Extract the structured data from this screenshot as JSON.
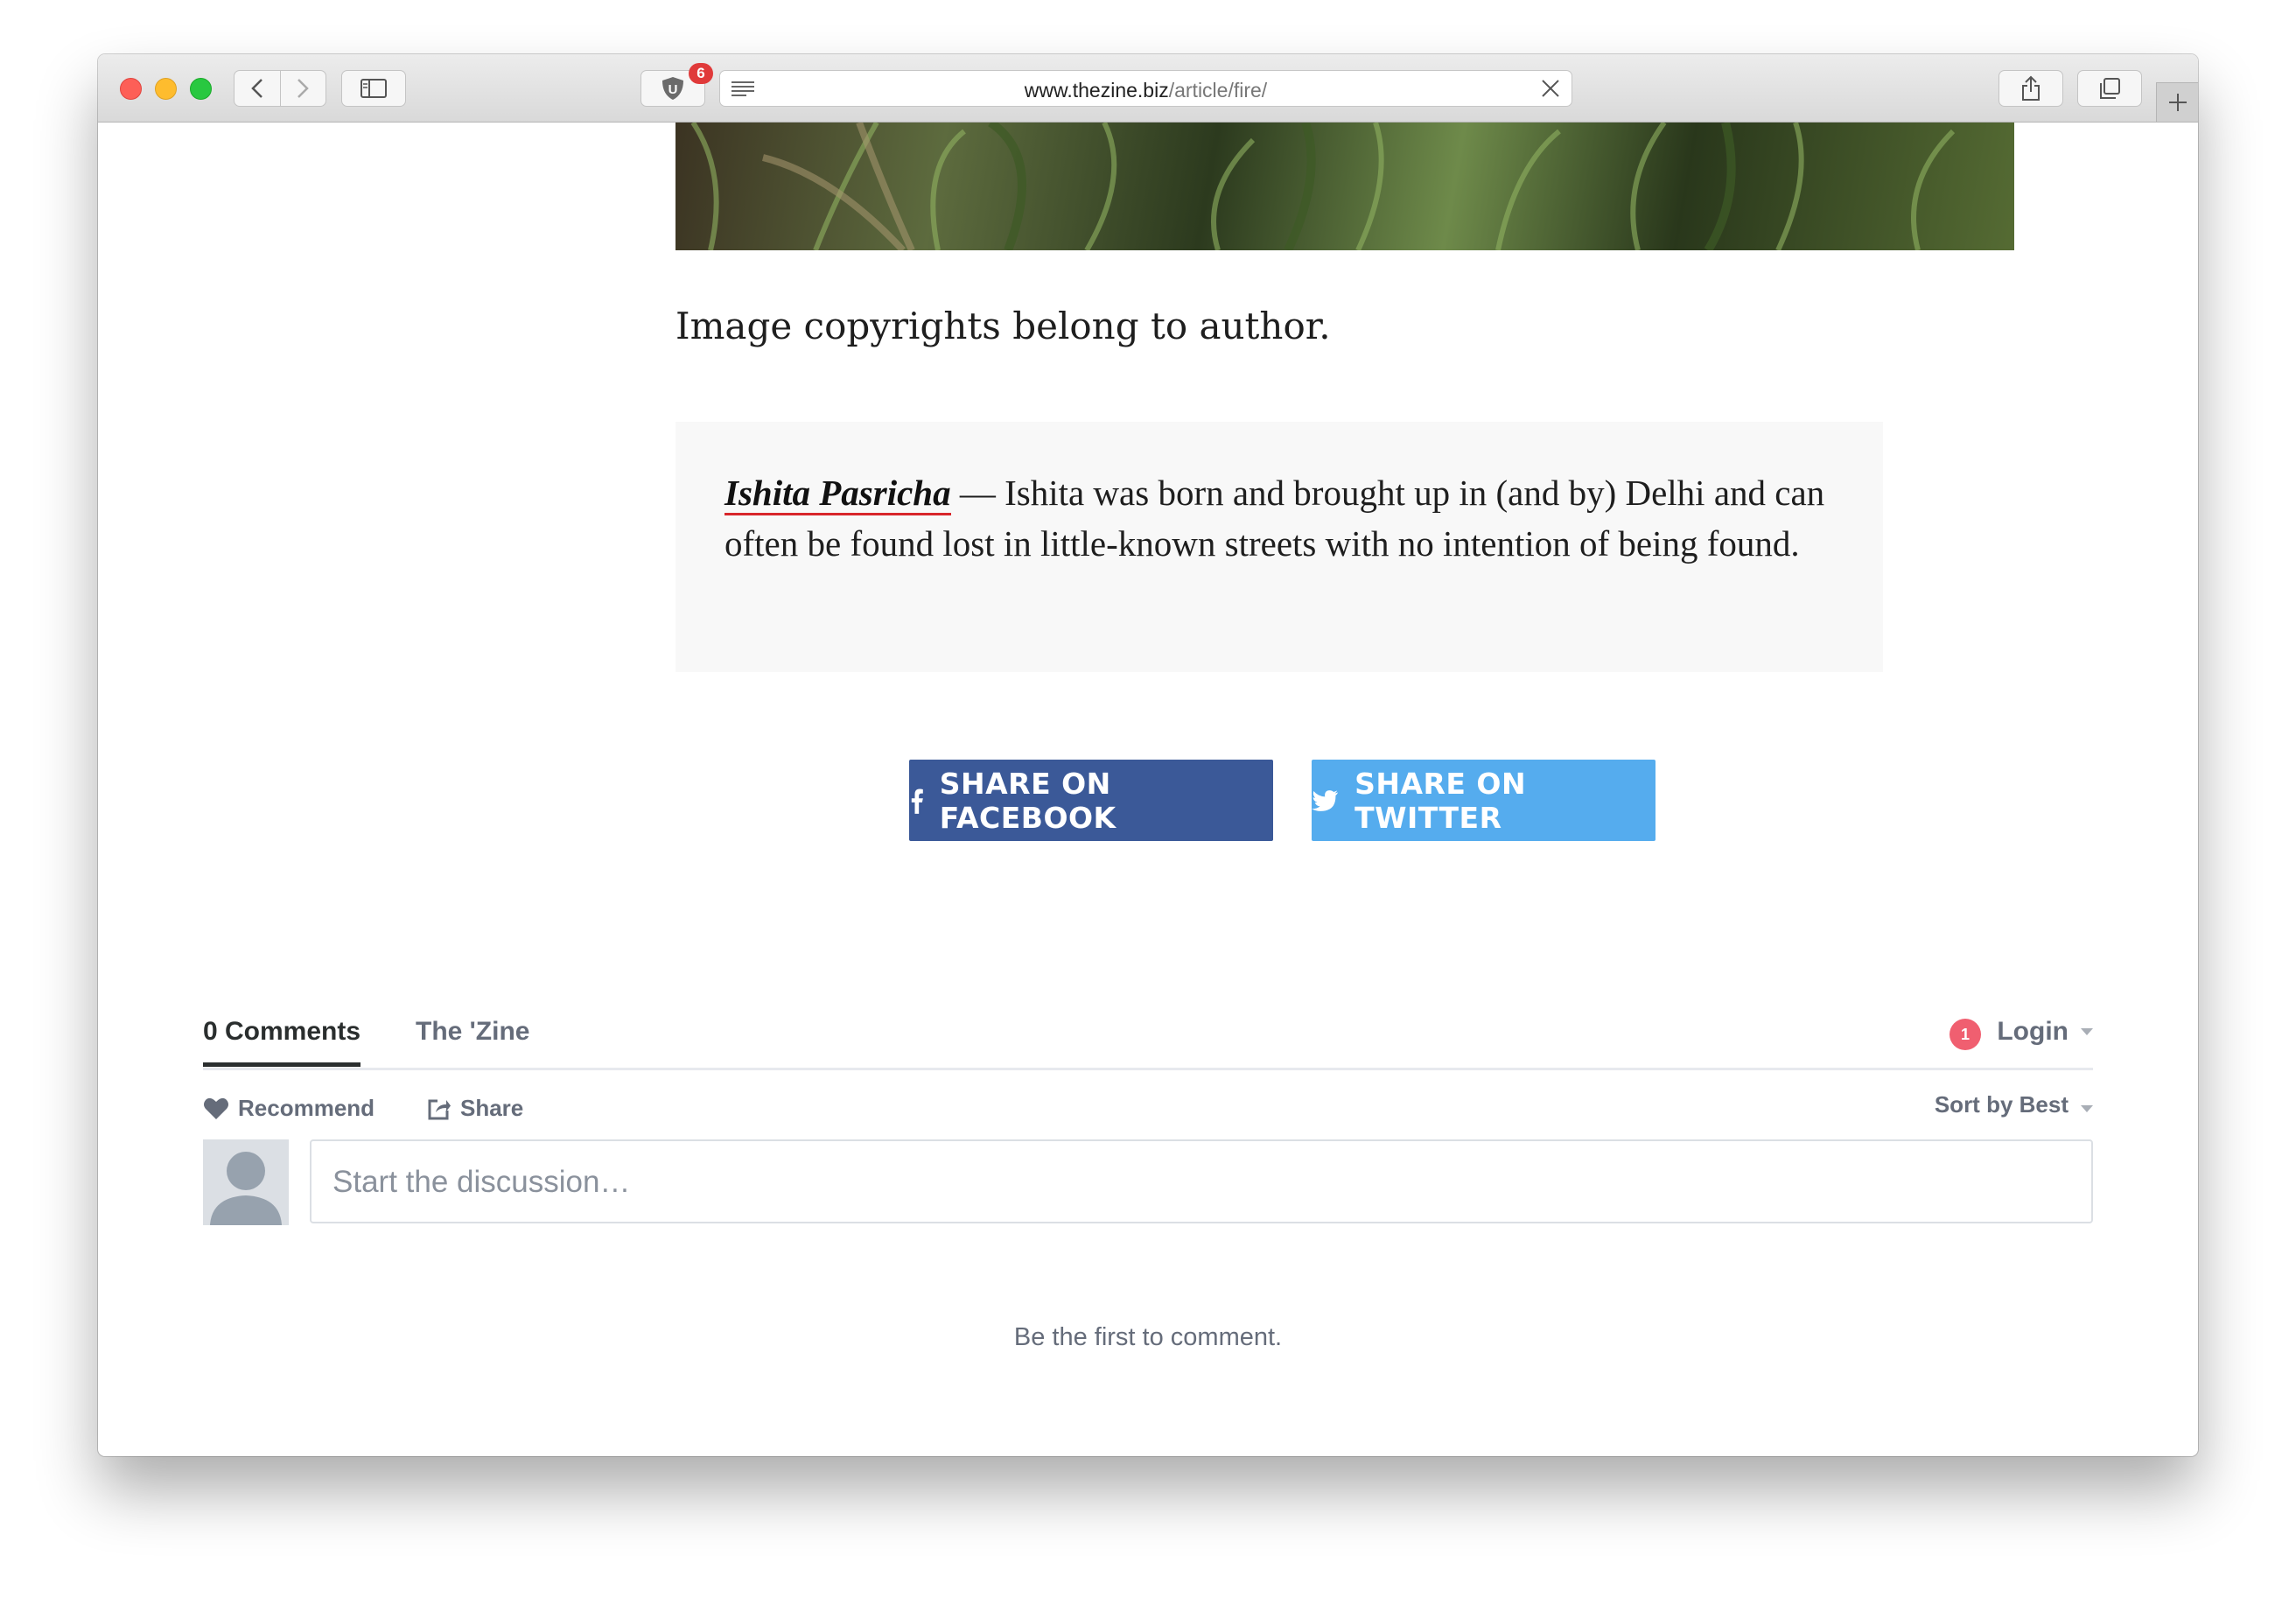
{
  "browser": {
    "url_domain": "www.thezine.biz",
    "url_path": "/article/fire/",
    "extension_badge_count": "6",
    "extension_icon_letter": "U"
  },
  "article": {
    "image_caption": "Image copyrights belong to author.",
    "author_name": "Ishita Pasricha",
    "bio_text": " — Ishita was born and brought up in (and by) Delhi and can often be found lost in little-known streets with no intention of being found."
  },
  "share": {
    "facebook_label": "SHARE ON FACEBOOK",
    "twitter_label": "SHARE ON TWITTER",
    "facebook_color": "#3b5998",
    "twitter_color": "#55acee"
  },
  "comments": {
    "tab_comments": "0 Comments",
    "tab_community": "The 'Zine",
    "notification_count": "1",
    "login_label": "Login",
    "recommend_label": "Recommend",
    "share_label": "Share",
    "sort_label": "Sort by Best",
    "input_placeholder": "Start the discussion…",
    "empty_message": "Be the first to comment."
  }
}
